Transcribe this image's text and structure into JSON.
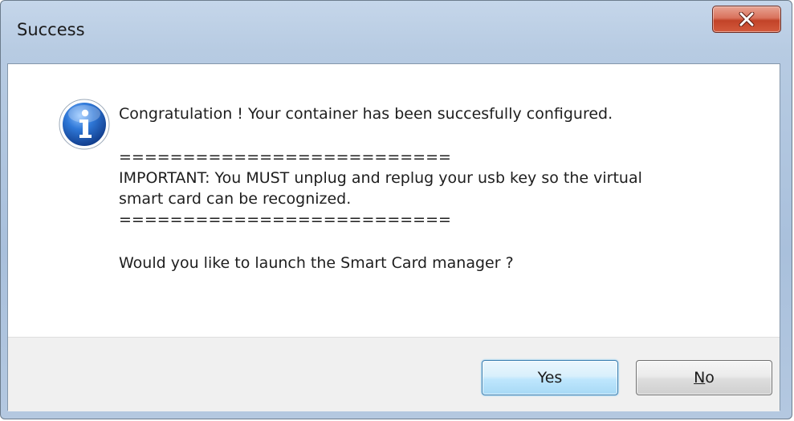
{
  "window": {
    "title": "Success",
    "close_icon": "close-icon"
  },
  "message": {
    "icon": "info-icon",
    "lines": [
      "Congratulation ! Your container has been succesfully configured.",
      "==========================",
      "IMPORTANT: You MUST unplug and replug your usb key so the virtual",
      "smart card can be recognized.",
      "==========================",
      "Would you like to launch the Smart Card manager ?"
    ]
  },
  "buttons": {
    "yes_label": "Yes",
    "no_mnemonic": "N",
    "no_rest": "o"
  },
  "colors": {
    "default_button_border": "#3c7fb1",
    "info_icon_blue": "#1f5fb6",
    "close_button_red": "#c24328"
  }
}
